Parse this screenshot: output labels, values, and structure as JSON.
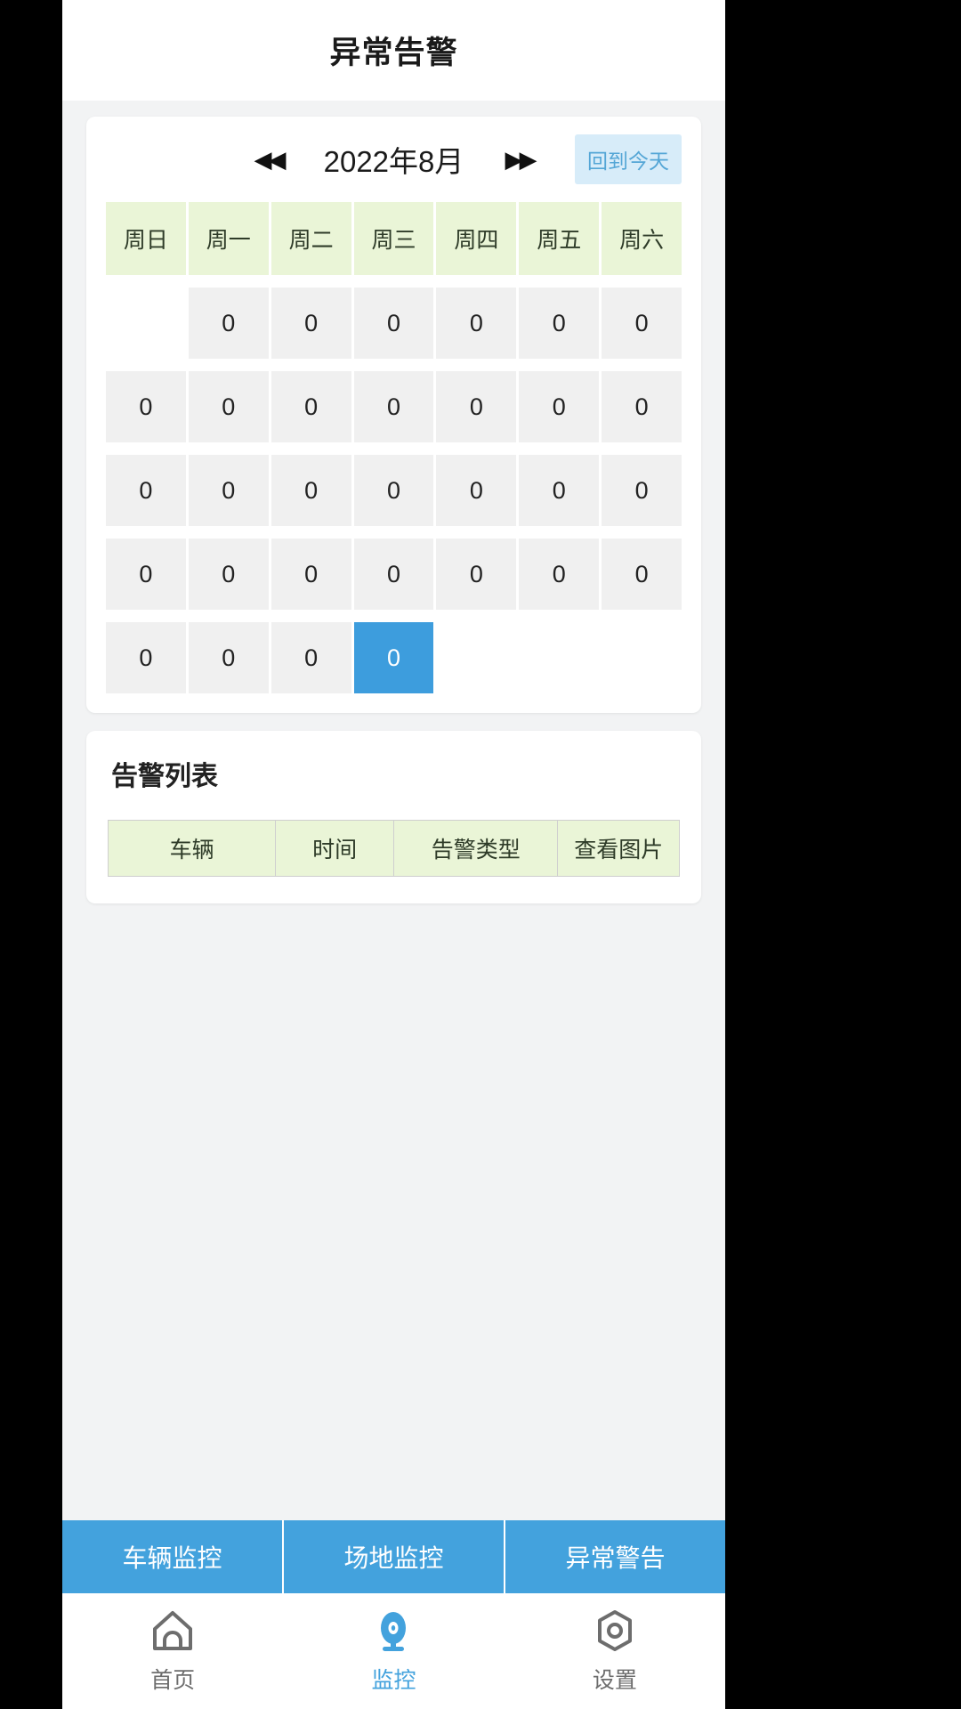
{
  "header": {
    "title": "异常告警"
  },
  "calendar": {
    "prev_label": "◀◀",
    "next_label": "▶▶",
    "month_label": "2022年8月",
    "today_button": "回到今天",
    "weekdays": [
      "周日",
      "周一",
      "周二",
      "周三",
      "周四",
      "周五",
      "周六"
    ],
    "rows": [
      [
        {
          "value": "",
          "empty": true,
          "selected": false
        },
        {
          "value": "0",
          "empty": false,
          "selected": false
        },
        {
          "value": "0",
          "empty": false,
          "selected": false
        },
        {
          "value": "0",
          "empty": false,
          "selected": false
        },
        {
          "value": "0",
          "empty": false,
          "selected": false
        },
        {
          "value": "0",
          "empty": false,
          "selected": false
        },
        {
          "value": "0",
          "empty": false,
          "selected": false
        }
      ],
      [
        {
          "value": "0",
          "empty": false,
          "selected": false
        },
        {
          "value": "0",
          "empty": false,
          "selected": false
        },
        {
          "value": "0",
          "empty": false,
          "selected": false
        },
        {
          "value": "0",
          "empty": false,
          "selected": false
        },
        {
          "value": "0",
          "empty": false,
          "selected": false
        },
        {
          "value": "0",
          "empty": false,
          "selected": false
        },
        {
          "value": "0",
          "empty": false,
          "selected": false
        }
      ],
      [
        {
          "value": "0",
          "empty": false,
          "selected": false
        },
        {
          "value": "0",
          "empty": false,
          "selected": false
        },
        {
          "value": "0",
          "empty": false,
          "selected": false
        },
        {
          "value": "0",
          "empty": false,
          "selected": false
        },
        {
          "value": "0",
          "empty": false,
          "selected": false
        },
        {
          "value": "0",
          "empty": false,
          "selected": false
        },
        {
          "value": "0",
          "empty": false,
          "selected": false
        }
      ],
      [
        {
          "value": "0",
          "empty": false,
          "selected": false
        },
        {
          "value": "0",
          "empty": false,
          "selected": false
        },
        {
          "value": "0",
          "empty": false,
          "selected": false
        },
        {
          "value": "0",
          "empty": false,
          "selected": false
        },
        {
          "value": "0",
          "empty": false,
          "selected": false
        },
        {
          "value": "0",
          "empty": false,
          "selected": false
        },
        {
          "value": "0",
          "empty": false,
          "selected": false
        }
      ],
      [
        {
          "value": "0",
          "empty": false,
          "selected": false
        },
        {
          "value": "0",
          "empty": false,
          "selected": false
        },
        {
          "value": "0",
          "empty": false,
          "selected": false
        },
        {
          "value": "0",
          "empty": false,
          "selected": true
        },
        {
          "value": "",
          "empty": true,
          "selected": false
        },
        {
          "value": "",
          "empty": true,
          "selected": false
        },
        {
          "value": "",
          "empty": true,
          "selected": false
        }
      ]
    ],
    "selected_color": "#3d9ddd",
    "weekday_header_color": "#eaf5d7",
    "cell_color": "#f0f0f0"
  },
  "alert_list": {
    "title": "告警列表",
    "columns": [
      "车辆",
      "时间",
      "告警类型",
      "查看图片"
    ],
    "rows": []
  },
  "segment_tabs": [
    {
      "label": "车辆监控"
    },
    {
      "label": "场地监控"
    },
    {
      "label": "异常警告"
    }
  ],
  "bottom_nav": {
    "active_color": "#43a2dd",
    "items": [
      {
        "label": "首页",
        "icon": "home-icon",
        "active": false
      },
      {
        "label": "监控",
        "icon": "camera-icon",
        "active": true
      },
      {
        "label": "设置",
        "icon": "gear-icon",
        "active": false
      }
    ]
  }
}
